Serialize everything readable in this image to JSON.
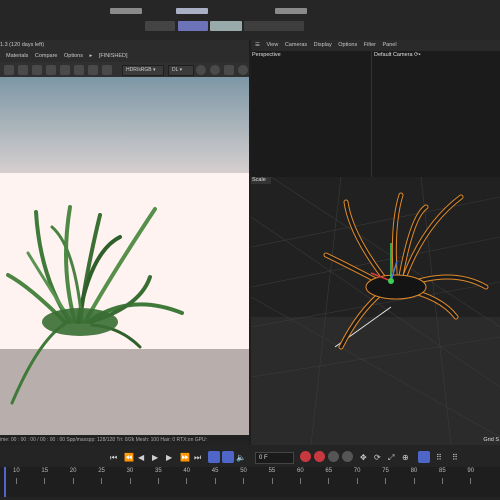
{
  "left": {
    "title": "1.3 (120 days left)",
    "menu": [
      "Materials",
      "Compare",
      "Options",
      "▸",
      "[FINISHED]"
    ],
    "lut": "HDR/sRGB",
    "mode": "DL",
    "status": "ime: 00 : 00 : 00 / 00 : 00 : 00  Spp/maxspp: 128/128   Tri: 0/2k  Mesh: 100  Hair: 0   RTX:on   GPU:"
  },
  "right": {
    "menu": [
      "View",
      "Cameras",
      "Display",
      "Options",
      "Filter",
      "Panel"
    ],
    "viewport_top_left": "Perspective",
    "viewport_top_right": "Default Camera ⟳•",
    "viewport_bottom_label": "Scale",
    "grid_label": "Grid S"
  },
  "timeline": {
    "frame": "0 F",
    "ticks": [
      "10",
      "15",
      "20",
      "25",
      "30",
      "35",
      "40",
      "45",
      "50",
      "55",
      "60",
      "65",
      "70",
      "75",
      "80",
      "85",
      "90"
    ]
  },
  "colors": {
    "selection_orange": "#e08a2c",
    "sky": "#7c95a3",
    "floor": "#bdb2ae"
  }
}
